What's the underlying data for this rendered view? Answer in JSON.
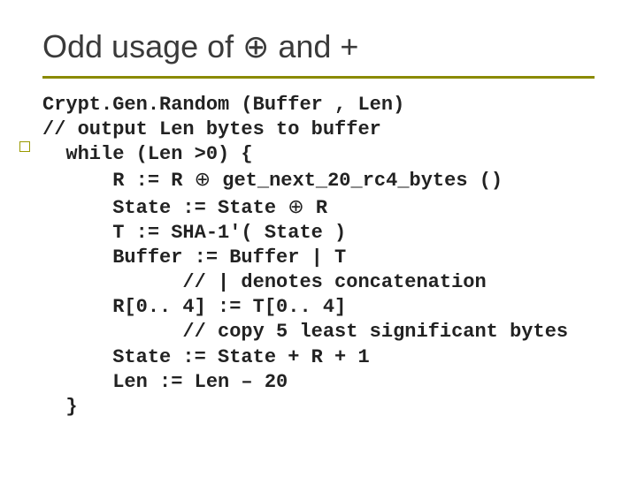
{
  "title": {
    "pre": "Odd usage of ",
    "oplus": "⊕",
    "post": " and +"
  },
  "code": {
    "l01": "Crypt.Gen.Random (Buffer , Len)",
    "l02": "// output Len bytes to buffer",
    "l03": "  while (Len >0) {",
    "l04a": "      R := R ",
    "l04b": " get_next_20_rc4_bytes ()",
    "l05a": "      State := State ",
    "l05b": " R",
    "l06": "      T := SHA-1'( State )",
    "l07": "      Buffer := Buffer | T",
    "l08": "            // | denotes concatenation",
    "l09": "      R[0.. 4] := T[0.. 4]",
    "l10": "            // copy 5 least significant bytes",
    "l11": "      State := State + R + 1",
    "l12": "      Len := Len – 20",
    "l13": "  }",
    "oplus": "⊕"
  }
}
